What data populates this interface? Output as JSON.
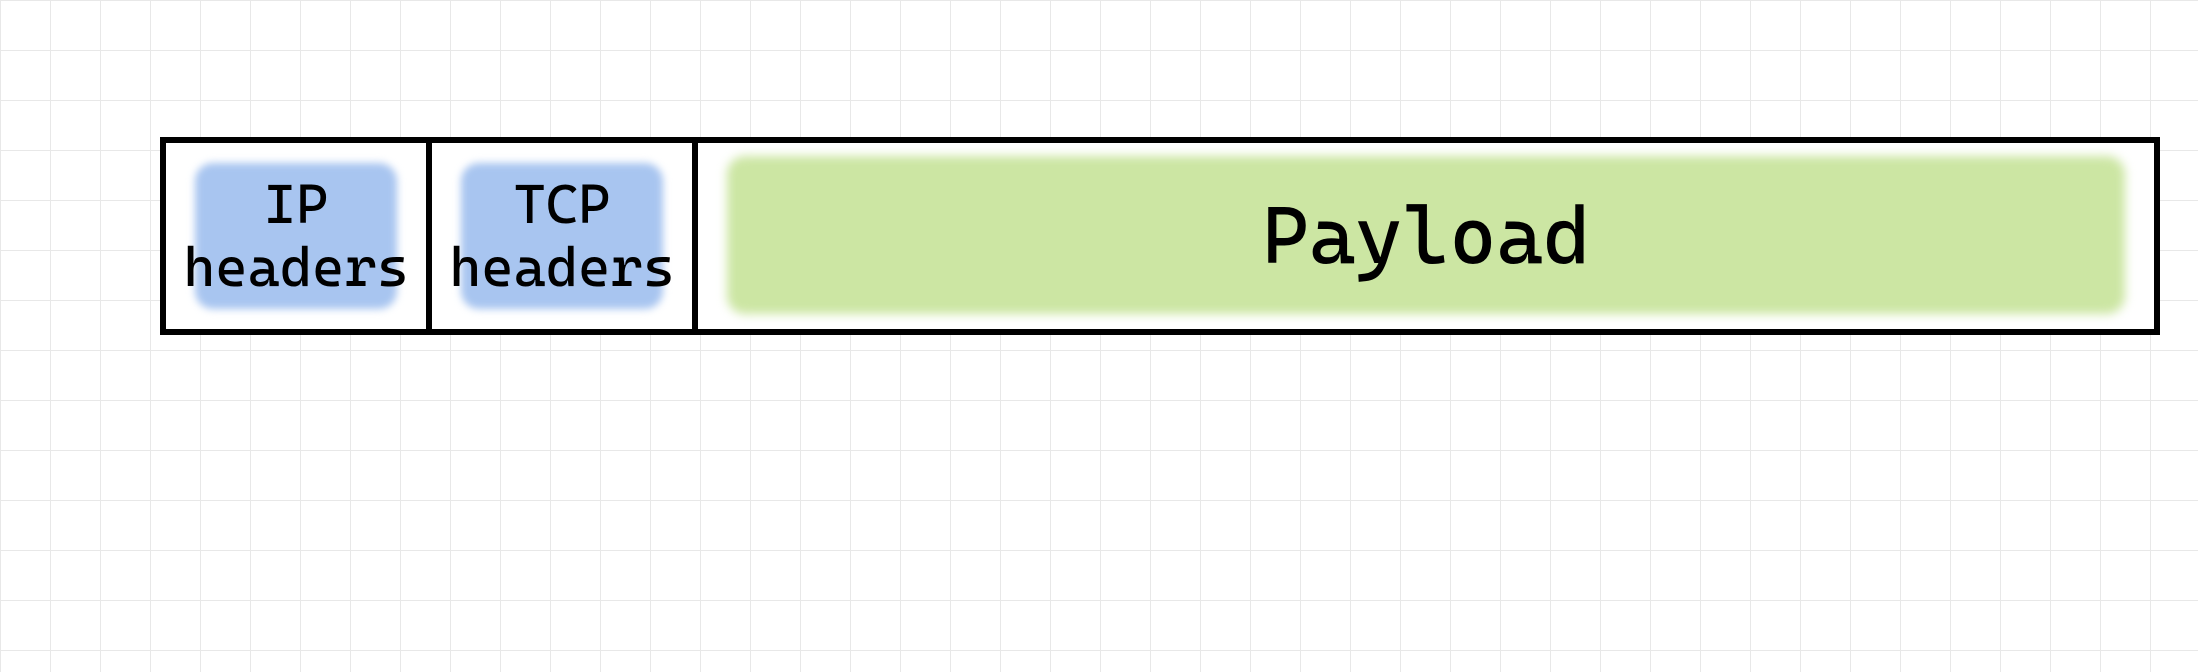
{
  "diagram": {
    "type": "packet-structure",
    "segments": [
      {
        "id": "ip-headers",
        "label": "IP\nheaders",
        "highlight_color": "#a8c5f0",
        "relative_width": "small"
      },
      {
        "id": "tcp-headers",
        "label": "TCP\nheaders",
        "highlight_color": "#a8c5f0",
        "relative_width": "small"
      },
      {
        "id": "payload",
        "label": "Payload",
        "highlight_color": "#cce6a3",
        "relative_width": "large"
      }
    ]
  }
}
